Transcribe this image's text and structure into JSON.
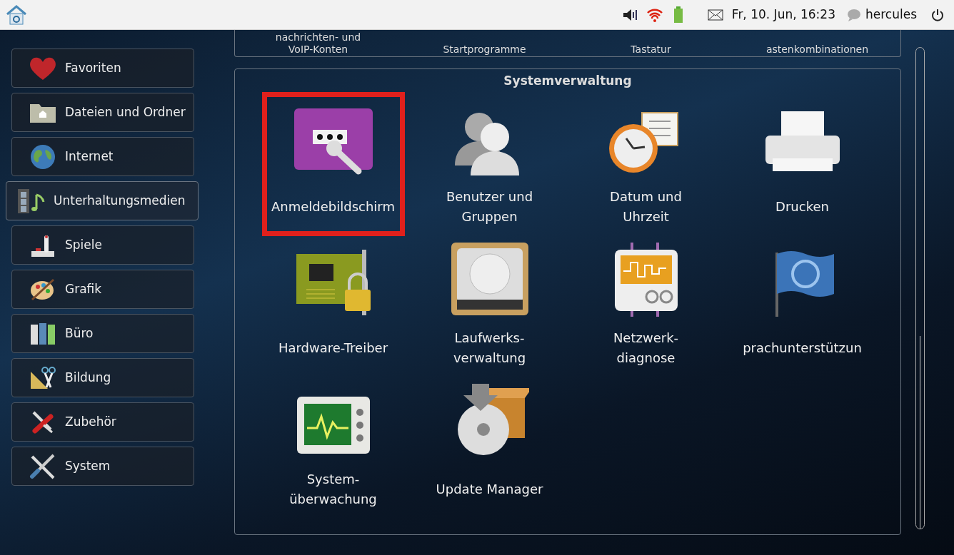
{
  "top_bar": {
    "clock": "Fr, 10. Jun, 16:23",
    "user": "hercules"
  },
  "sidebar": {
    "items": [
      {
        "label": "Favoriten",
        "selected": false
      },
      {
        "label": "Dateien und Ordner",
        "selected": false
      },
      {
        "label": "Internet",
        "selected": false
      },
      {
        "label": "Unterhaltungsmedien",
        "selected": true
      },
      {
        "label": "Spiele",
        "selected": false
      },
      {
        "label": "Grafik",
        "selected": false
      },
      {
        "label": "Büro",
        "selected": false
      },
      {
        "label": "Bildung",
        "selected": false
      },
      {
        "label": "Zubehör",
        "selected": false
      },
      {
        "label": "System",
        "selected": false
      }
    ]
  },
  "previous_section": {
    "items": [
      {
        "lines": [
          "nachrichten- und",
          "VoIP-Konten"
        ]
      },
      {
        "lines": [
          "Startprogramme"
        ]
      },
      {
        "lines": [
          "Tastatur"
        ]
      },
      {
        "lines": [
          "astenkombinationen"
        ]
      }
    ]
  },
  "section": {
    "title": "Systemverwaltung",
    "items": [
      {
        "lines": [
          "Anmeldebildschirm"
        ],
        "selected": true
      },
      {
        "lines": [
          "Benutzer und",
          "Gruppen"
        ],
        "selected": false
      },
      {
        "lines": [
          "Datum und",
          "Uhrzeit"
        ],
        "selected": false
      },
      {
        "lines": [
          "Drucken"
        ],
        "selected": false
      },
      {
        "lines": [
          "Hardware-Treiber"
        ],
        "selected": false
      },
      {
        "lines": [
          "Laufwerks-",
          "verwaltung"
        ],
        "selected": false
      },
      {
        "lines": [
          "Netzwerk-",
          "diagnose"
        ],
        "selected": false
      },
      {
        "lines": [
          "prachunterstützun"
        ],
        "selected": false
      },
      {
        "lines": [
          "System-",
          "überwachung"
        ],
        "selected": false
      },
      {
        "lines": [
          "Update Manager"
        ],
        "selected": false
      }
    ]
  }
}
